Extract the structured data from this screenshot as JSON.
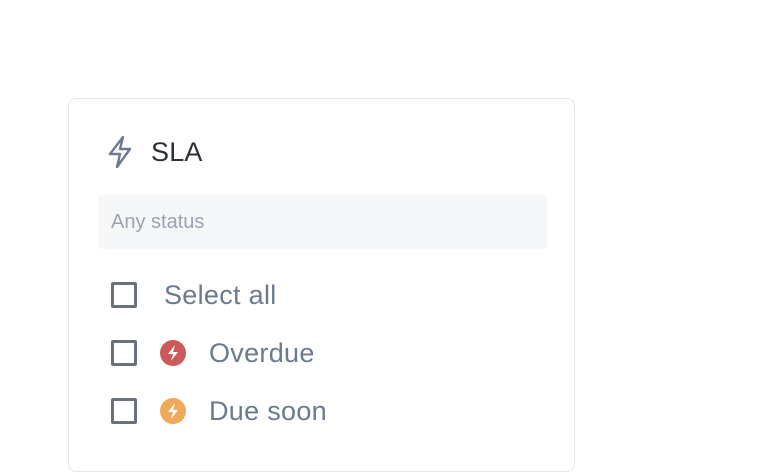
{
  "filter": {
    "title": "SLA",
    "title_icon": "lightning-bolt-icon",
    "search_placeholder": "Any status",
    "select_all_label": "Select all",
    "options": [
      {
        "label": "Overdue",
        "icon": "lightning-bolt-icon",
        "color": "#cc5a5a",
        "checked": false
      },
      {
        "label": "Due soon",
        "icon": "lightning-bolt-icon",
        "color": "#f0a85a",
        "checked": false
      }
    ],
    "select_all_checked": false
  },
  "colors": {
    "title_text": "#2b2f36",
    "option_text": "#6b7a90",
    "icon_stroke": "#6b7a90",
    "placeholder": "#9aa3af",
    "checkbox_border": "#6b717a",
    "overdue": "#cc5a5a",
    "due_soon": "#f0a85a"
  }
}
